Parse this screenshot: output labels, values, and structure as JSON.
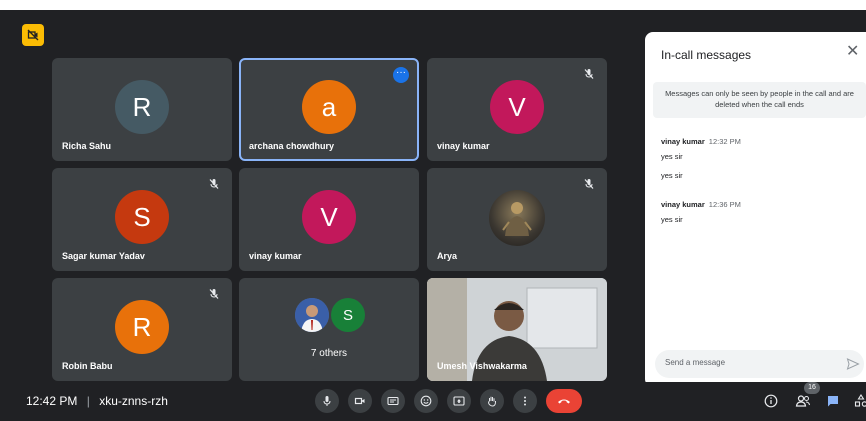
{
  "meeting": {
    "time": "12:42 PM",
    "separator": "|",
    "code": "xku-znns-rzh"
  },
  "participants": [
    {
      "name": "Richa Sahu",
      "initial": "R",
      "color": "#455a64"
    },
    {
      "name": "archana chowdhury",
      "initial": "a",
      "color": "#e8710a"
    },
    {
      "name": "vinay kumar",
      "initial": "V",
      "color": "#c2185b"
    },
    {
      "name": "Sagar kumar Yadav",
      "initial": "S",
      "color": "#c5390f"
    },
    {
      "name": "vinay kumar",
      "initial": "V",
      "color": "#c2185b"
    },
    {
      "name": "Arya",
      "initial": "",
      "color": "#4e4a43"
    },
    {
      "name": "Robin Babu",
      "initial": "R",
      "color": "#e8710a"
    },
    {
      "name": "7 others",
      "initial": "S",
      "color": "#188038"
    },
    {
      "name": "Umesh Vishwakarma",
      "initial": "",
      "color": "#7a7a7a"
    }
  ],
  "people_count": "16",
  "chat": {
    "title": "In-call messages",
    "notice": "Messages can only be seen by people in the call and are deleted when the call ends",
    "messages": [
      {
        "sender": "vinay kumar",
        "time": "12:32 PM",
        "lines": [
          "yes sir",
          "yes sir"
        ]
      },
      {
        "sender": "vinay kumar",
        "time": "12:36 PM",
        "lines": [
          "yes sir"
        ]
      }
    ],
    "placeholder": "Send a message"
  },
  "colors": {
    "background": "#202124",
    "tile": "#3c4043",
    "accent": "#8ab4f8",
    "end_call": "#ea4335",
    "chat_active": "#8ab4f8"
  }
}
